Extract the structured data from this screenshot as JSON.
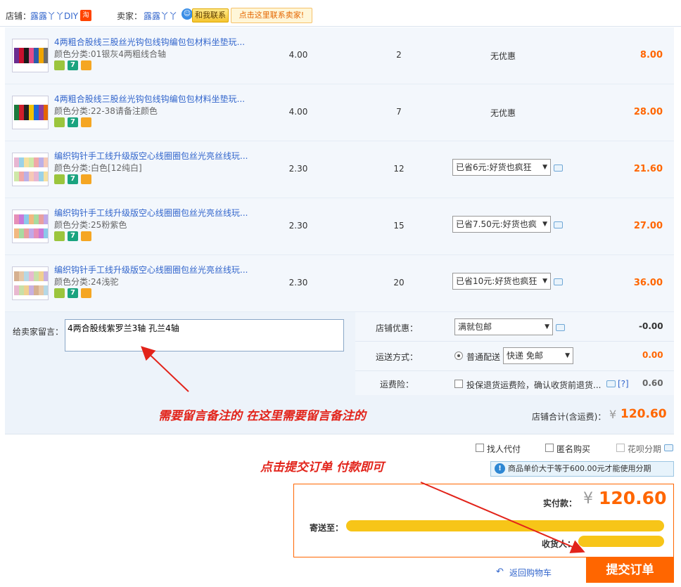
{
  "header": {
    "shop_label": "店铺：",
    "shop_name": "露露丫丫DIY",
    "tao_badge": "淘",
    "seller_label": "卖家：",
    "seller_name": "露露丫丫",
    "contact_btn": "和我联系",
    "contact_tip": "点击这里联系卖家!"
  },
  "items": [
    {
      "title": "4两粗合股线三股丝光钩包线钩编包包材料坐垫玩...",
      "sku": "颜色分类:01银灰4两粗线合轴",
      "price": "4.00",
      "qty": "2",
      "promo": "无优惠",
      "subtotal": "8.00",
      "promo_type": "text"
    },
    {
      "title": "4两粗合股线三股丝光钩包线钩编包包材料坐垫玩...",
      "sku": "颜色分类:22-38请备注颜色",
      "price": "4.00",
      "qty": "7",
      "promo": "无优惠",
      "subtotal": "28.00",
      "promo_type": "text"
    },
    {
      "title": "编织钩针手工线升级版空心线圈圈包丝光亮丝线玩...",
      "sku": "颜色分类:白色[12纯白]",
      "price": "2.30",
      "qty": "12",
      "promo": "已省6元:好货也疯狂",
      "subtotal": "21.60",
      "promo_type": "select"
    },
    {
      "title": "编织钩针手工线升级版空心线圈圈包丝光亮丝线玩...",
      "sku": "颜色分类:25粉紫色",
      "price": "2.30",
      "qty": "15",
      "promo": "已省7.50元:好货也疯",
      "subtotal": "27.00",
      "promo_type": "select"
    },
    {
      "title": "编织钩针手工线升级版空心线圈圈包丝光亮丝线玩...",
      "sku": "颜色分类:24浅驼",
      "price": "2.30",
      "qty": "20",
      "promo": "已省10元:好货也疯狂",
      "subtotal": "36.00",
      "promo_type": "select"
    }
  ],
  "memo": {
    "label": "给卖家留言：",
    "value": "4两合股线紫罗兰3轴 孔兰4轴"
  },
  "options": {
    "shop_discount_label": "店铺优惠：",
    "shop_discount_value": "满就包邮",
    "shop_discount_amount": "-0.00",
    "shipping_label": "运送方式：",
    "shipping_radio": "普通配送",
    "shipping_value": "快递 免邮",
    "shipping_amount": "0.00",
    "insurance_label": "运费险：",
    "insurance_text": "投保退货运费险，确认收货前退货...",
    "insurance_help": "[?]",
    "insurance_amount": "0.60"
  },
  "shop_total": {
    "label": "店铺合计(含运费)：",
    "currency": "¥",
    "amount": "120.60"
  },
  "annotations": {
    "memo_note": "需要留言备注的  在这里需要留言备注的",
    "submit_note": "点击提交订单  付款即可"
  },
  "extras": {
    "pay_for_me": "找人代付",
    "anonymous": "匿名购买",
    "huabei": "花呗分期",
    "installment_tip": "商品单价大于等于600.00元才能使用分期"
  },
  "payment": {
    "label": "实付款：",
    "currency": "¥",
    "amount": "120.60",
    "ship_to_label": "寄送至：",
    "receiver_label": "收货人："
  },
  "footer": {
    "back_link": "返回购物车",
    "submit": "提交订单"
  },
  "colors": {
    "accent": "#ff6600",
    "link": "#3366cc",
    "annotation": "#e2231a"
  }
}
